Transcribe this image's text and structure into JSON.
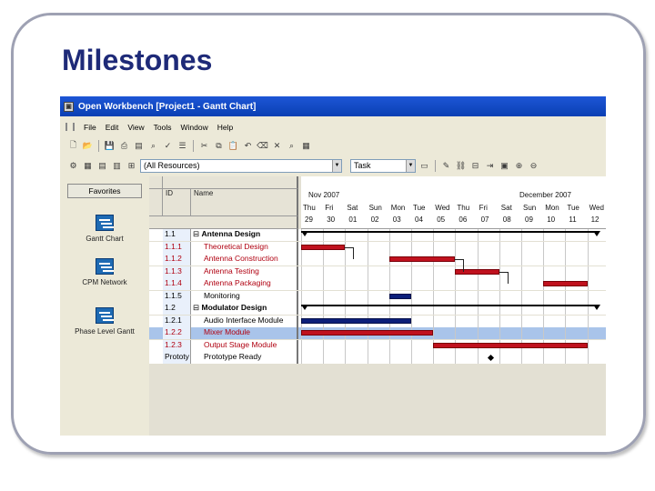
{
  "slide": {
    "title": "Milestones"
  },
  "window": {
    "title": "Open Workbench   [Project1 - Gantt Chart]"
  },
  "menu": [
    "File",
    "Edit",
    "View",
    "Tools",
    "Window",
    "Help"
  ],
  "toolbar": {
    "resources_combo": "(All Resources)",
    "task_combo": "Task"
  },
  "sidebar": {
    "favorites_label": "Favorites",
    "items": [
      "Gantt Chart",
      "CPM Network",
      "Phase Level Gantt"
    ]
  },
  "grid": {
    "col_id": "ID",
    "col_name": "Name",
    "rows": [
      {
        "id": "1.1",
        "name": "Antenna Design",
        "type": "phase",
        "color": "#000000"
      },
      {
        "id": "1.1.1",
        "name": "Theoretical Design",
        "type": "task",
        "color": "#b00010"
      },
      {
        "id": "1.1.2",
        "name": "Antenna Construction",
        "type": "task",
        "color": "#b00010"
      },
      {
        "id": "1.1.3",
        "name": "Antenna Testing",
        "type": "task",
        "color": "#b00010"
      },
      {
        "id": "1.1.4",
        "name": "Antenna Packaging",
        "type": "task",
        "color": "#b00010"
      },
      {
        "id": "1.1.5",
        "name": "Monitoring",
        "type": "task",
        "color": "#000000"
      },
      {
        "id": "1.2",
        "name": "Modulator Design",
        "type": "phase",
        "color": "#000000"
      },
      {
        "id": "1.2.1",
        "name": "Audio Interface Module",
        "type": "task",
        "color": "#000000"
      },
      {
        "id": "1.2.2",
        "name": "Mixer Module",
        "type": "task",
        "color": "#b00010"
      },
      {
        "id": "1.2.3",
        "name": "Output Stage Module",
        "type": "task",
        "color": "#b00010"
      },
      {
        "id": "Prototy",
        "name": "Prototype Ready",
        "type": "milestone",
        "color": "#000000"
      }
    ]
  },
  "timeline": {
    "month1": "Nov 2007",
    "month2": "December 2007",
    "days": [
      {
        "dow": "Thu",
        "date": "29"
      },
      {
        "dow": "Fri",
        "date": "30"
      },
      {
        "dow": "Sat",
        "date": "01"
      },
      {
        "dow": "Sun",
        "date": "02"
      },
      {
        "dow": "Mon",
        "date": "03"
      },
      {
        "dow": "Tue",
        "date": "04"
      },
      {
        "dow": "Wed",
        "date": "05"
      },
      {
        "dow": "Thu",
        "date": "06"
      },
      {
        "dow": "Fri",
        "date": "07"
      },
      {
        "dow": "Sat",
        "date": "08"
      },
      {
        "dow": "Sun",
        "date": "09"
      },
      {
        "dow": "Mon",
        "date": "10"
      },
      {
        "dow": "Tue",
        "date": "11"
      },
      {
        "dow": "Wed",
        "date": "12"
      }
    ]
  },
  "colors": {
    "critical": "#c0111e",
    "normal": "#0c1f7a",
    "selected_row": "#a9c4ea"
  }
}
